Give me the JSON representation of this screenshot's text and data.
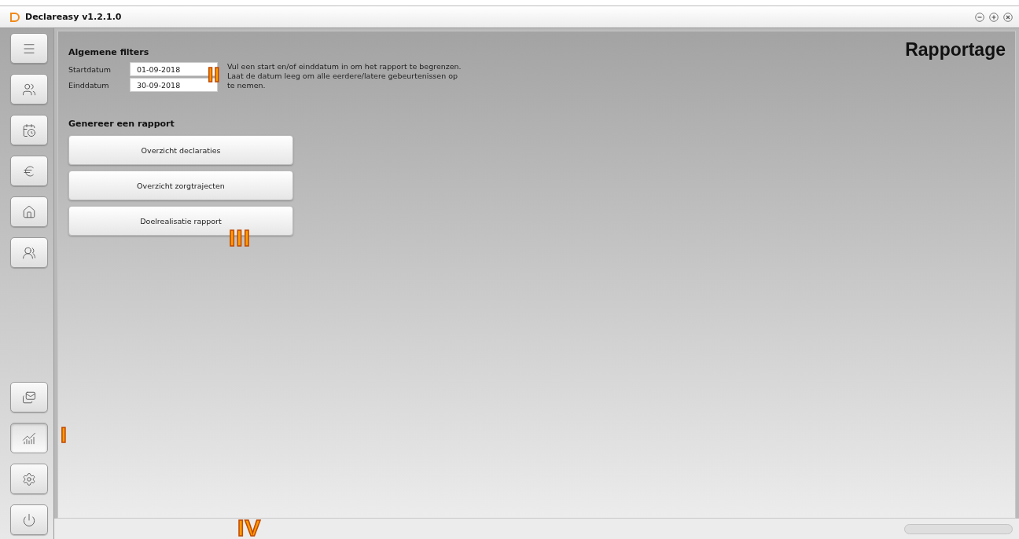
{
  "window": {
    "title": "Declareasy v1.2.1.0"
  },
  "sidebar": {
    "top_items": [
      {
        "selected": false
      },
      {
        "selected": false
      },
      {
        "selected": false
      },
      {
        "selected": false
      },
      {
        "selected": false
      },
      {
        "selected": false
      }
    ],
    "bottom_items": [
      {
        "selected": false
      },
      {
        "selected": true
      },
      {
        "selected": false
      },
      {
        "selected": false
      }
    ]
  },
  "page": {
    "title": "Rapportage",
    "filters": {
      "heading": "Algemene filters",
      "fields": [
        {
          "label": "Startdatum",
          "value": "01-09-2018"
        },
        {
          "label": "Einddatum",
          "value": "30-09-2018"
        }
      ],
      "hint": "Vul een start en/of einddatum in om het rapport te begrenzen. Laat de datum leeg om alle eerdere/latere gebeurtenissen op te nemen."
    },
    "reports": {
      "heading": "Genereer een rapport",
      "buttons": [
        "Overzicht declaraties",
        "Overzicht zorgtrajecten",
        "Doelrealisatie rapport"
      ]
    }
  },
  "annotations": [
    "I",
    "II",
    "III",
    "IV"
  ]
}
